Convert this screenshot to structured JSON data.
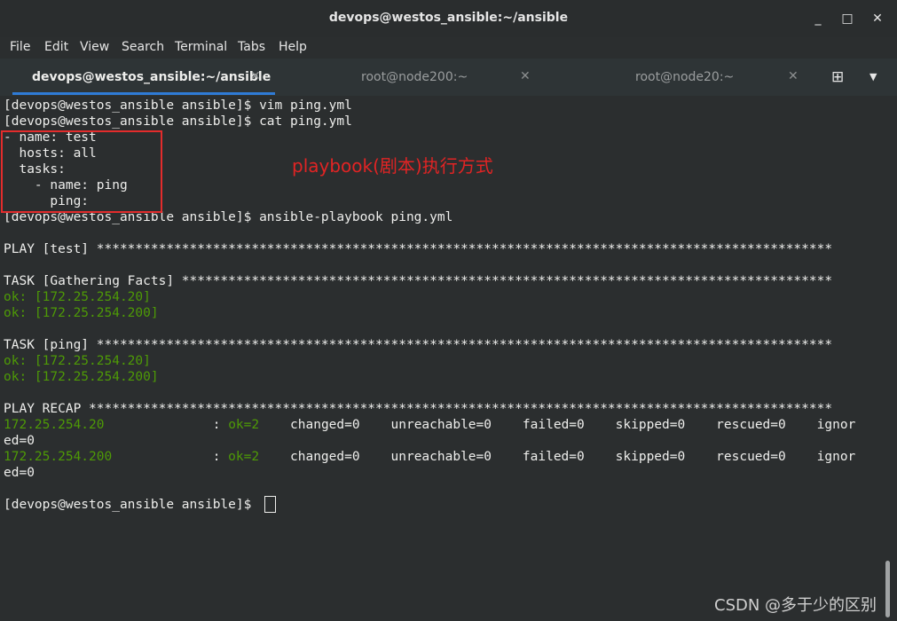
{
  "window": {
    "title": "devops@westos_ansible:~/ansible",
    "minimize": "_",
    "maximize": "□",
    "close": "✕"
  },
  "menu": [
    "File",
    "Edit",
    "View",
    "Search",
    "Terminal",
    "Tabs",
    "Help"
  ],
  "tabs": [
    {
      "label": "devops@westos_ansible:~/ansible",
      "close": "✕"
    },
    {
      "label": "root@node200:~",
      "close": "✕"
    },
    {
      "label": "root@node20:~",
      "close": "✕"
    }
  ],
  "tabbar_icons": {
    "new_tab": "⊞",
    "dropdown": "▼"
  },
  "terminal": {
    "lines": [
      "[devops@westos_ansible ansible]$ vim ping.yml",
      "[devops@westos_ansible ansible]$ cat ping.yml",
      "- name: test",
      "  hosts: all",
      "  tasks:",
      "    - name: ping",
      "      ping:",
      "[devops@westos_ansible ansible]$ ansible-playbook ping.yml",
      "",
      "PLAY [test] ***********************************************************************************************",
      "",
      "TASK [Gathering Facts] ************************************************************************************",
      "ok: [172.25.254.20]",
      "ok: [172.25.254.200]",
      "",
      "TASK [ping] ***********************************************************************************************",
      "ok: [172.25.254.20]",
      "ok: [172.25.254.200]",
      "",
      "PLAY RECAP ************************************************************************************************",
      "172.25.254.20              : ok=2    changed=0    unreachable=0    failed=0    skipped=0    rescued=0    ignor",
      "ed=0",
      "172.25.254.200             : ok=2    changed=0    unreachable=0    failed=0    skipped=0    rescued=0    ignor",
      "ed=0",
      "",
      "[devops@westos_ansible ansible]$ "
    ],
    "recap": [
      {
        "host": "172.25.254.20",
        "sep": "              : ",
        "ok": "ok=2",
        "rest": "    changed=0    unreachable=0    failed=0    skipped=0    rescued=0    ignor"
      },
      {
        "host": "172.25.254.200",
        "sep": "             : ",
        "ok": "ok=2",
        "rest": "    changed=0    unreachable=0    failed=0    skipped=0    rescued=0    ignor"
      }
    ]
  },
  "annotation": "playbook(剧本)执行方式",
  "watermark": "CSDN @多于少的区别",
  "colors": {
    "ok_green": "#4e9a06",
    "annotation_red": "#e02424",
    "tab_accent": "#2f7bd6"
  }
}
